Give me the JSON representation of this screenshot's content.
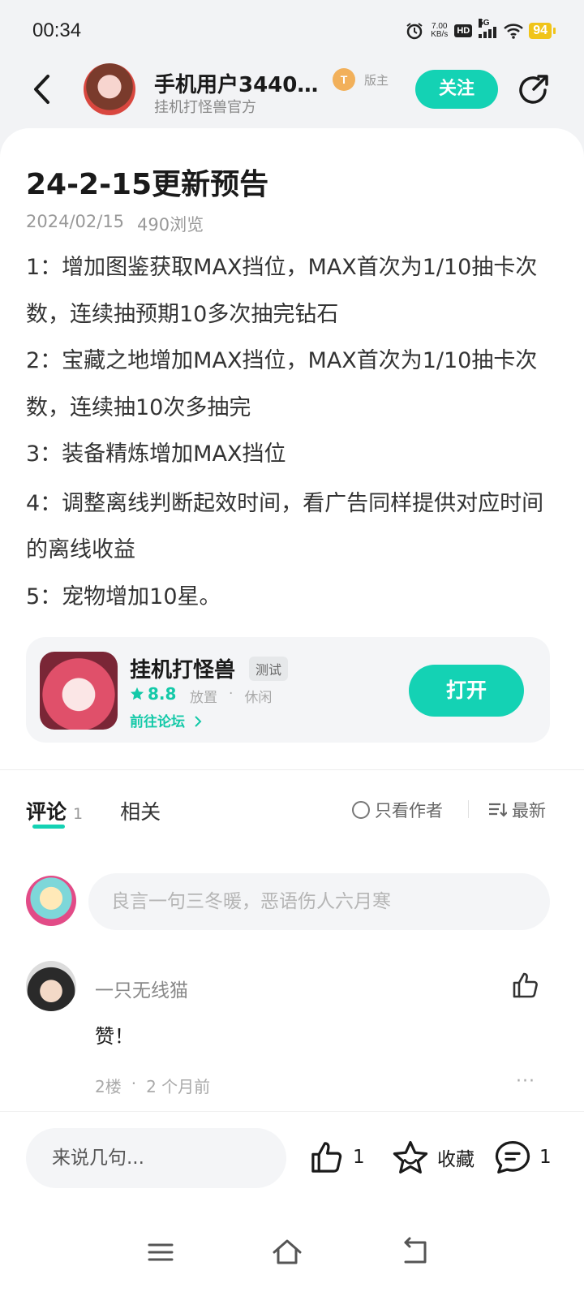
{
  "status": {
    "time": "00:34",
    "net_speed": "7.00",
    "net_unit": "KB/s",
    "hd": "HD",
    "network": "5G",
    "battery": "94"
  },
  "header": {
    "username": "手机用户3440…",
    "subtitle": "挂机打怪兽官方",
    "level": "T",
    "role": "版主",
    "follow_label": "关注"
  },
  "post": {
    "title": "24-2-15更新预告",
    "date": "2024/02/15",
    "views": "490浏览",
    "paragraphs": [
      "1：增加图鉴获取MAX挡位，MAX首次为1/10抽卡次数，连续抽预期10多次抽完钻石",
      "2：宝藏之地增加MAX挡位，MAX首次为1/10抽卡次数，连续抽10次多抽完",
      "3：装备精炼增加MAX挡位",
      "4：调整离线判断起效时间，看广告同样提供对应时间的离线收益",
      "5：宠物增加10星。"
    ]
  },
  "game": {
    "name": "挂机打怪兽",
    "tag": "测试",
    "rating": "8.8",
    "category1": "放置",
    "dot": "·",
    "category2": "休闲",
    "forum_link": "前往论坛",
    "open_label": "打开"
  },
  "tabs": {
    "comment_label": "评论",
    "comment_count": "1",
    "related_label": "相关",
    "author_only": "只看作者",
    "sort_label": "最新"
  },
  "comment_input": {
    "placeholder": "良言一句三冬暖，恶语伤人六月寒"
  },
  "comments": [
    {
      "author": "一只无线猫",
      "text": "赞！",
      "floor": "2楼",
      "dot": "·",
      "time": "2 个月前",
      "more": "···"
    }
  ],
  "bottom_bar": {
    "reply_placeholder": "来说几句...",
    "like_count": "1",
    "favorite_label": "收藏",
    "comment_count": "1"
  },
  "icons": {
    "back": "back-arrow-icon",
    "share": "share-icon",
    "like": "thumbs-up-icon",
    "favorite": "star-icon",
    "comment": "comment-bubble-icon"
  },
  "colors": {
    "accent": "#14d2b4",
    "battery": "#f0c419",
    "level_badge": "#f2b05a"
  }
}
